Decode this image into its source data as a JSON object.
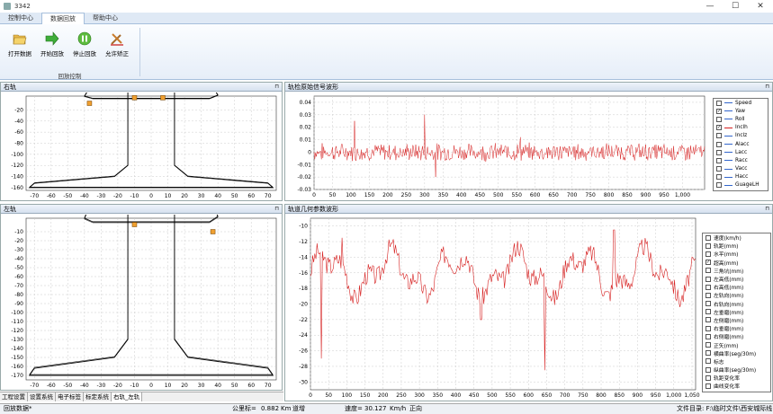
{
  "window": {
    "title": "3342",
    "min": "—",
    "max": "☐",
    "close": "✕"
  },
  "tabs": [
    "控制中心",
    "数据回放",
    "帮助中心"
  ],
  "ribbon": {
    "buttons": [
      {
        "label": "打开数据",
        "icon": "folder-open-icon"
      },
      {
        "label": "开始回放",
        "icon": "arrow-right-icon"
      },
      {
        "label": "停止回放",
        "icon": "pause-icon"
      },
      {
        "label": "允许矫正",
        "icon": "wrench-icon"
      }
    ],
    "group": "回放控制"
  },
  "panels": {
    "right_rail": "右轨",
    "left_rail": "左轨",
    "signal": "轨检原始信号波形",
    "geometry": "轨道几何参数波形",
    "pin": "⊓"
  },
  "bottom_tabs": [
    "工程设置",
    "设置系统",
    "电子标签",
    "标定系统",
    "右轨_左轨"
  ],
  "status": {
    "mode": "回放数据*",
    "mileage_label": "公里标=",
    "mileage_value": "0.882",
    "mileage_unit": "Km",
    "track": "道增",
    "speed_label": "速度=",
    "speed_value": "30.127",
    "speed_unit": "Km/h",
    "direction": "正向",
    "file": "文件目录: F:\\临时文件\\西安城际线"
  },
  "signal_legend": [
    {
      "name": "Speed",
      "checked": false,
      "color": "#3366cc"
    },
    {
      "name": "Yaw",
      "checked": true,
      "color": "#3366cc"
    },
    {
      "name": "Roll",
      "checked": false,
      "color": "#3366cc"
    },
    {
      "name": "Inclh",
      "checked": true,
      "color": "#d62020"
    },
    {
      "name": "Inclz",
      "checked": false,
      "color": "#3366cc"
    },
    {
      "name": "Alacc",
      "checked": false,
      "color": "#3366cc"
    },
    {
      "name": "Lacc",
      "checked": false,
      "color": "#3366cc"
    },
    {
      "name": "Racc",
      "checked": false,
      "color": "#3366cc"
    },
    {
      "name": "Vacc",
      "checked": false,
      "color": "#3366cc"
    },
    {
      "name": "Hacc",
      "checked": false,
      "color": "#3366cc"
    },
    {
      "name": "GuageLH",
      "checked": false,
      "color": "#3366cc"
    }
  ],
  "geometry_legend": [
    {
      "name": "速度(km/h)",
      "checked": false
    },
    {
      "name": "轨距(mm)",
      "checked": false
    },
    {
      "name": "水平(mm)",
      "checked": false
    },
    {
      "name": "超高(mm)",
      "checked": true
    },
    {
      "name": "三角坑(mm)",
      "checked": false
    },
    {
      "name": "左高低(mm)",
      "checked": false
    },
    {
      "name": "右高低(mm)",
      "checked": false
    },
    {
      "name": "左轨向(mm)",
      "checked": false
    },
    {
      "name": "右轨向(mm)",
      "checked": false
    },
    {
      "name": "左垂磨(mm)",
      "checked": false
    },
    {
      "name": "左侧磨(mm)",
      "checked": false
    },
    {
      "name": "右垂磨(mm)",
      "checked": false
    },
    {
      "name": "右侧磨(mm)",
      "checked": false
    },
    {
      "name": "正矢(mm)",
      "checked": false
    },
    {
      "name": "横曲率(seg/30m)",
      "checked": false
    },
    {
      "name": "标志",
      "checked": false
    },
    {
      "name": "纵曲率(seg/30m)",
      "checked": false
    },
    {
      "name": "轨距变化率",
      "checked": false
    },
    {
      "name": "曲线变化率",
      "checked": false
    }
  ],
  "chart_data": [
    {
      "type": "line",
      "panel": "右轨",
      "x": [
        -75,
        -55,
        -40,
        -35,
        -30,
        -25,
        -22,
        -20,
        -15,
        -10,
        -7,
        0,
        8,
        10,
        15,
        20,
        22,
        25,
        30,
        35,
        40,
        48,
        50,
        55,
        73
      ],
      "xlabel": "",
      "ylabel": "",
      "xlim": [
        -75,
        75
      ],
      "ylim": [
        -165,
        5
      ],
      "xticks": [
        -70,
        -60,
        -50,
        -40,
        -30,
        -20,
        -10,
        0,
        10,
        20,
        30,
        40,
        50,
        60,
        70
      ],
      "yticks": [
        -20,
        -40,
        -60,
        -80,
        -100,
        -120,
        -140,
        -160
      ],
      "markers": [
        {
          "x": -37,
          "y": -8
        },
        {
          "x": -10,
          "y": 2
        },
        {
          "x": 7,
          "y": 2
        }
      ]
    },
    {
      "type": "line",
      "panel": "左轨",
      "xlim": [
        -75,
        75
      ],
      "ylim": [
        -175,
        5
      ],
      "xticks": [
        -70,
        -60,
        -50,
        -40,
        -30,
        -20,
        -10,
        0,
        10,
        20,
        30,
        40,
        50,
        60,
        70
      ],
      "yticks": [
        -10,
        -20,
        -30,
        -40,
        -50,
        -60,
        -70,
        -80,
        -90,
        -100,
        -110,
        -120,
        -130,
        -140,
        -150,
        -160,
        -170
      ],
      "markers": [
        {
          "x": -10,
          "y": -2
        },
        {
          "x": 37,
          "y": -10
        }
      ]
    },
    {
      "type": "line",
      "panel": "轨检原始信号波形",
      "series": [
        {
          "name": "Inclh",
          "color": "#d62020"
        }
      ],
      "xlim": [
        0,
        1060
      ],
      "ylim": [
        -0.03,
        0.045
      ],
      "xticks": [
        0,
        50,
        100,
        150,
        200,
        250,
        300,
        350,
        400,
        450,
        500,
        550,
        600,
        650,
        700,
        750,
        800,
        850,
        900,
        950,
        1000
      ],
      "xticklabels": [
        "0",
        "50",
        "100",
        "150",
        "200",
        "250",
        "300",
        "350",
        "400",
        "450",
        "500",
        "550",
        "600",
        "650",
        "700",
        "750",
        "800",
        "850",
        "900",
        "950",
        "1,000"
      ],
      "yticks": [
        0.04,
        0.03,
        0.02,
        0.01,
        0,
        -0.01,
        -0.02,
        -0.03
      ],
      "yticklabels": [
        "0.04",
        "0.03",
        "0.02",
        "0.01",
        "0",
        "-0.01",
        "-0.02",
        "-0.03"
      ],
      "seed": 7,
      "noise": 0.006,
      "spikes": [
        [
          110,
          0.025
        ],
        [
          300,
          0.03
        ],
        [
          560,
          0.012
        ],
        [
          330,
          -0.02
        ]
      ]
    },
    {
      "type": "line",
      "panel": "轨道几何参数波形",
      "series": [
        {
          "name": "超高(mm)",
          "color": "#d62020"
        }
      ],
      "xlim": [
        0,
        1060
      ],
      "ylim": [
        -31,
        -9
      ],
      "xticks": [
        0,
        50,
        100,
        150,
        200,
        250,
        300,
        350,
        400,
        450,
        500,
        550,
        600,
        650,
        700,
        750,
        800,
        850,
        900,
        950,
        1000,
        1050
      ],
      "xticklabels": [
        "0",
        "50",
        "100",
        "150",
        "200",
        "250",
        "300",
        "350",
        "400",
        "450",
        "500",
        "550",
        "600",
        "650",
        "700",
        "750",
        "800",
        "850",
        "900",
        "950",
        "1,000",
        "1,050"
      ],
      "yticks": [
        -10,
        -12,
        -14,
        -16,
        -18,
        -20,
        -22,
        -24,
        -26,
        -28,
        -30
      ],
      "seed": 3
    }
  ]
}
